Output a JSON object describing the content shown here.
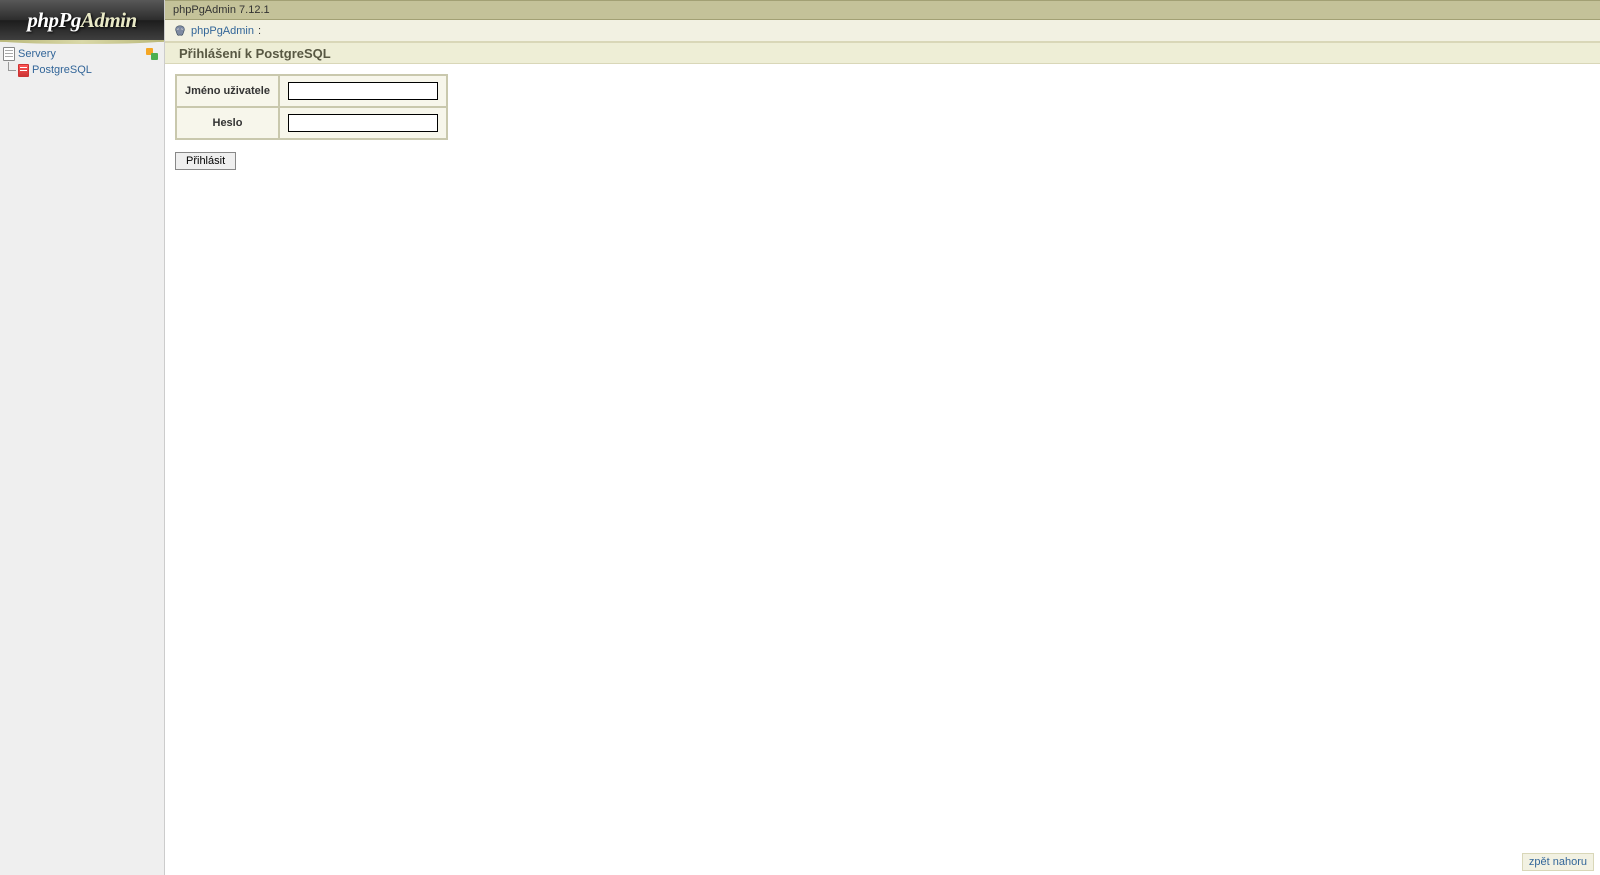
{
  "app": {
    "logo_prefix": "phpPg",
    "logo_suffix": "Admin",
    "version_line": "phpPgAdmin 7.12.1"
  },
  "sidebar": {
    "servers_label": "Servery",
    "items": [
      {
        "label": "PostgreSQL"
      }
    ]
  },
  "breadcrumb": {
    "root": "phpPgAdmin",
    "sep": ":"
  },
  "login": {
    "heading": "Přihlášení k PostgreSQL",
    "username_label": "Jméno uživatele",
    "password_label": "Heslo",
    "username_value": "",
    "password_value": "",
    "submit_label": "Přihlásit"
  },
  "footer": {
    "back_to_top": "zpět nahoru"
  }
}
